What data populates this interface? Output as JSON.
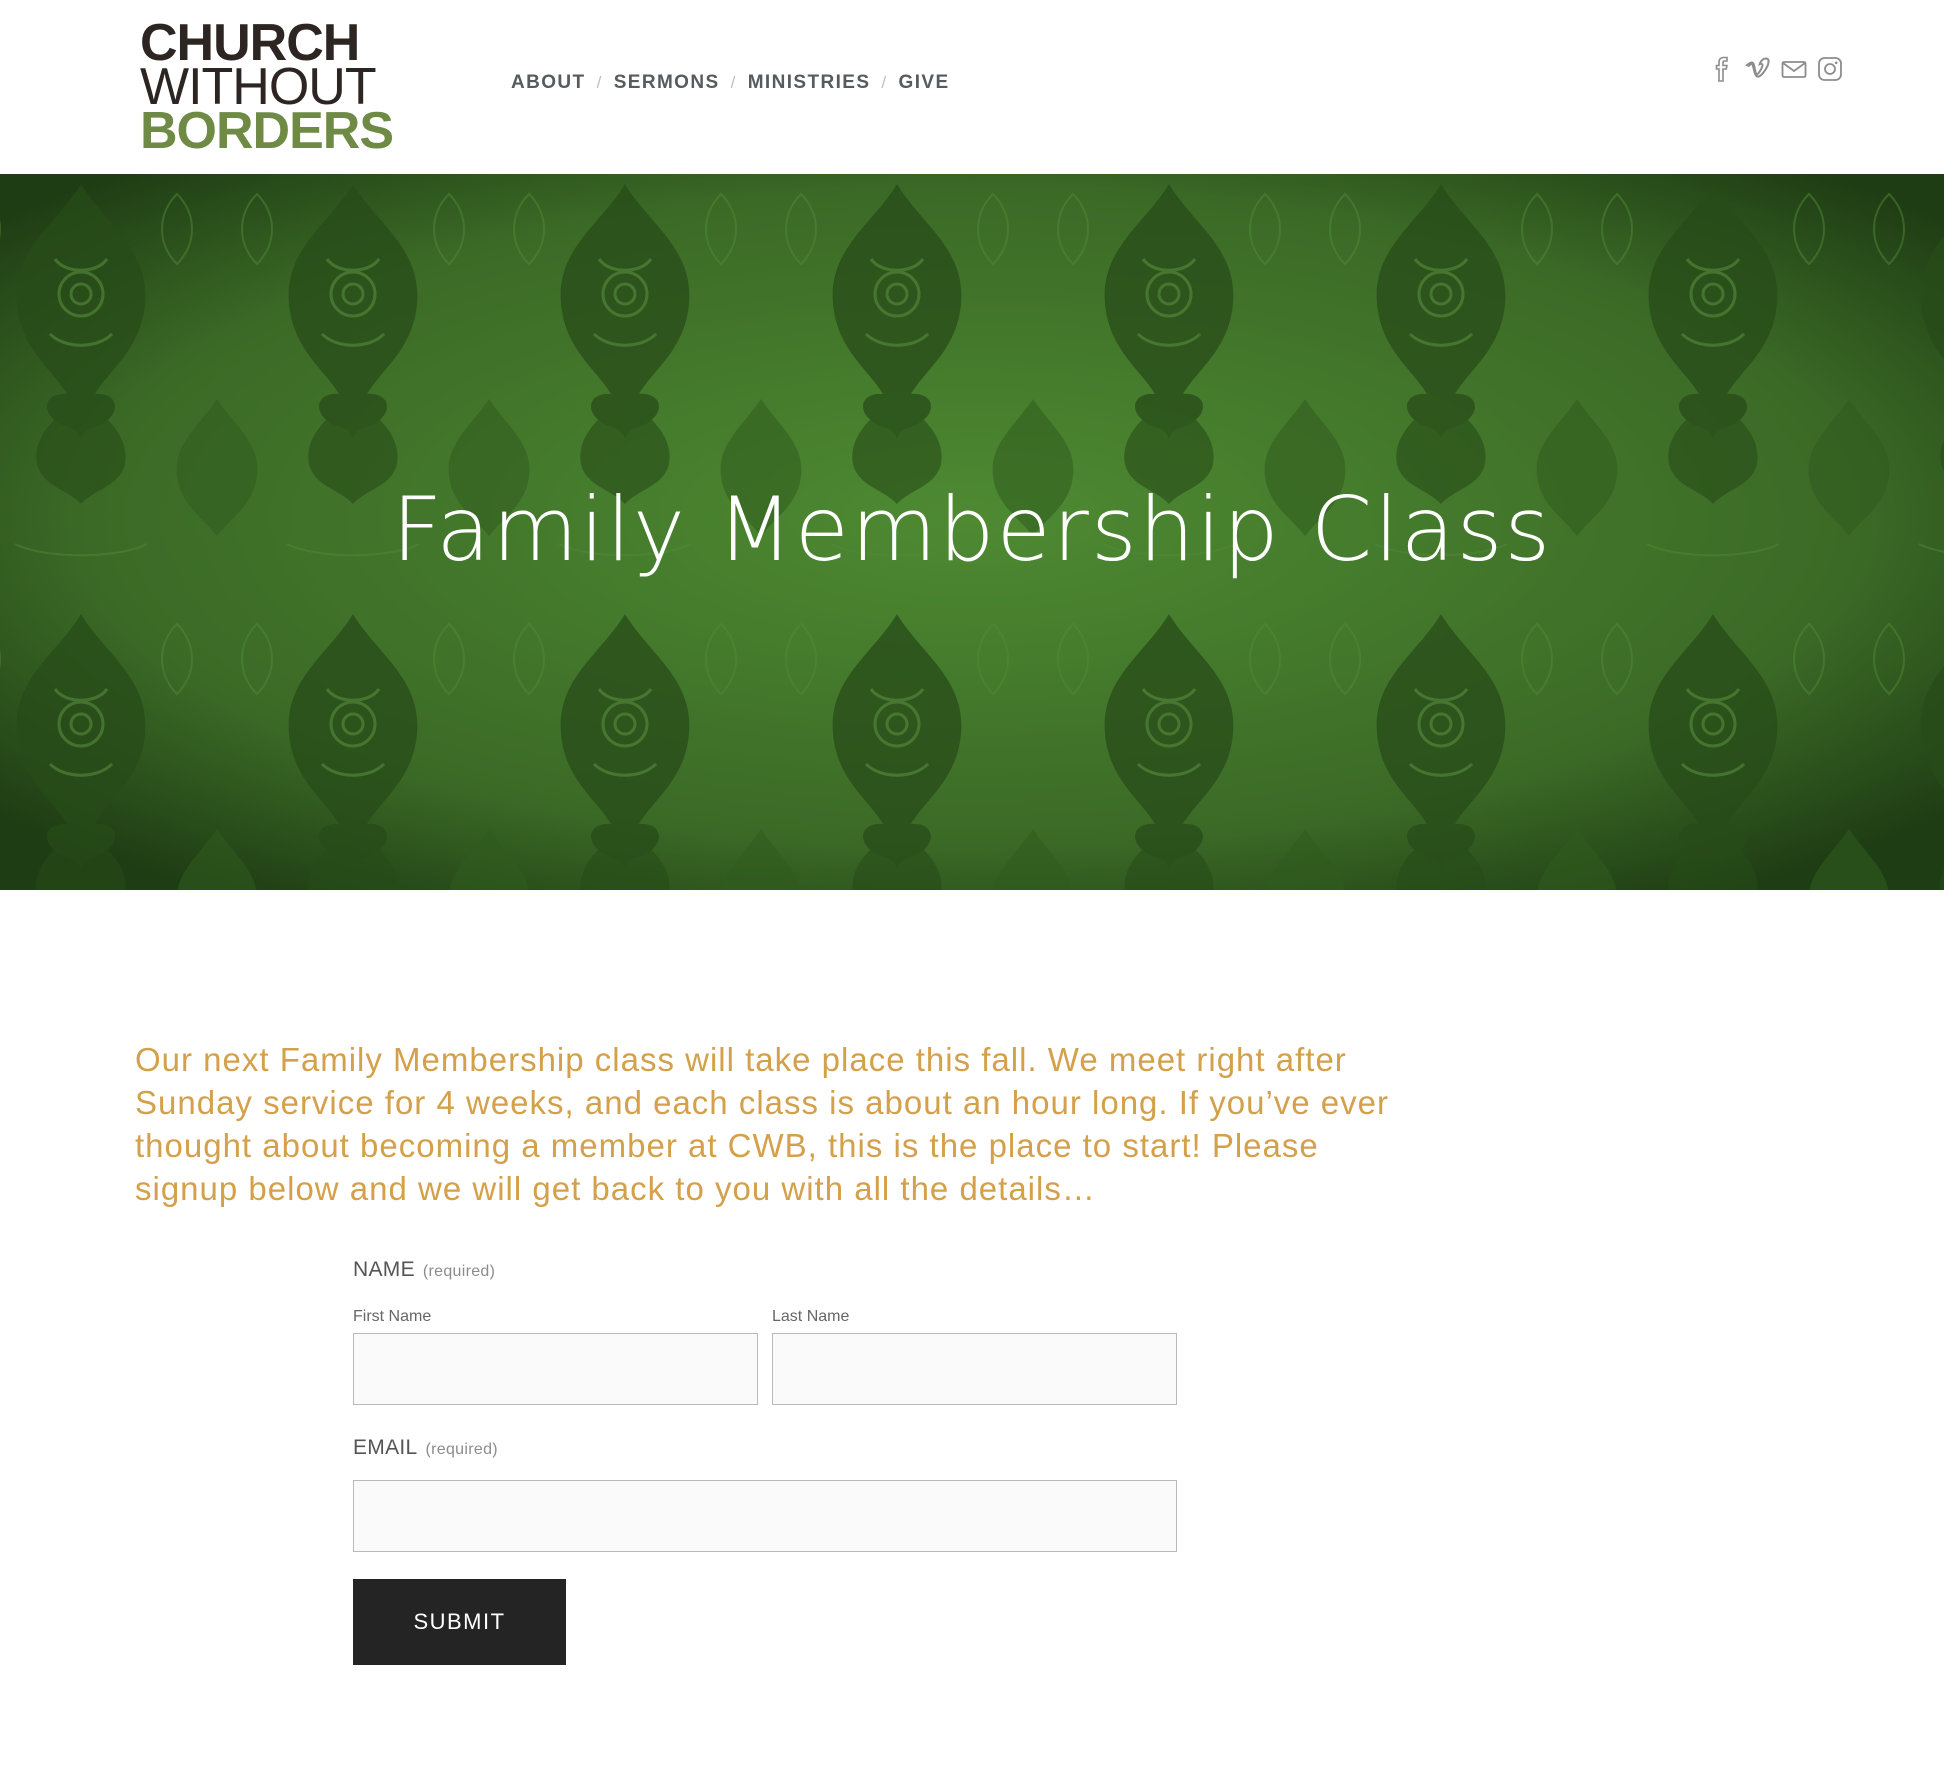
{
  "logo": {
    "line1": "CHURCH",
    "line2": "WITHOUT",
    "line3": "BORDERS"
  },
  "nav": {
    "items": [
      {
        "label": "ABOUT"
      },
      {
        "label": "SERMONS"
      },
      {
        "label": "MINISTRIES"
      },
      {
        "label": "GIVE"
      }
    ],
    "separator": "/"
  },
  "social": {
    "icons": [
      "facebook-icon",
      "vimeo-icon",
      "email-icon",
      "instagram-icon"
    ],
    "color": "#8d8d8d"
  },
  "hero": {
    "title": "Family Membership Class",
    "background_color": "#3e6e28",
    "pattern_color": "#2c5219"
  },
  "intro": {
    "text": "Our next Family Membership class will take place this fall. We meet right after Sunday service for 4 weeks, and each class is about an hour long. If you’ve ever thought about becoming a member at CWB, this is the place to start! Please signup below and we will get back to you with all the details…",
    "color": "#d4a04a"
  },
  "form": {
    "name": {
      "label": "NAME",
      "required": "(required)",
      "first_label": "First Name",
      "first_value": "",
      "last_label": "Last Name",
      "last_value": ""
    },
    "email": {
      "label": "EMAIL",
      "required": "(required)",
      "value": ""
    },
    "submit_label": "SUBMIT"
  },
  "colors": {
    "logo_dark": "#2d2522",
    "logo_green": "#6f8a45",
    "nav_text": "#555b5e",
    "button_bg": "#242424"
  }
}
